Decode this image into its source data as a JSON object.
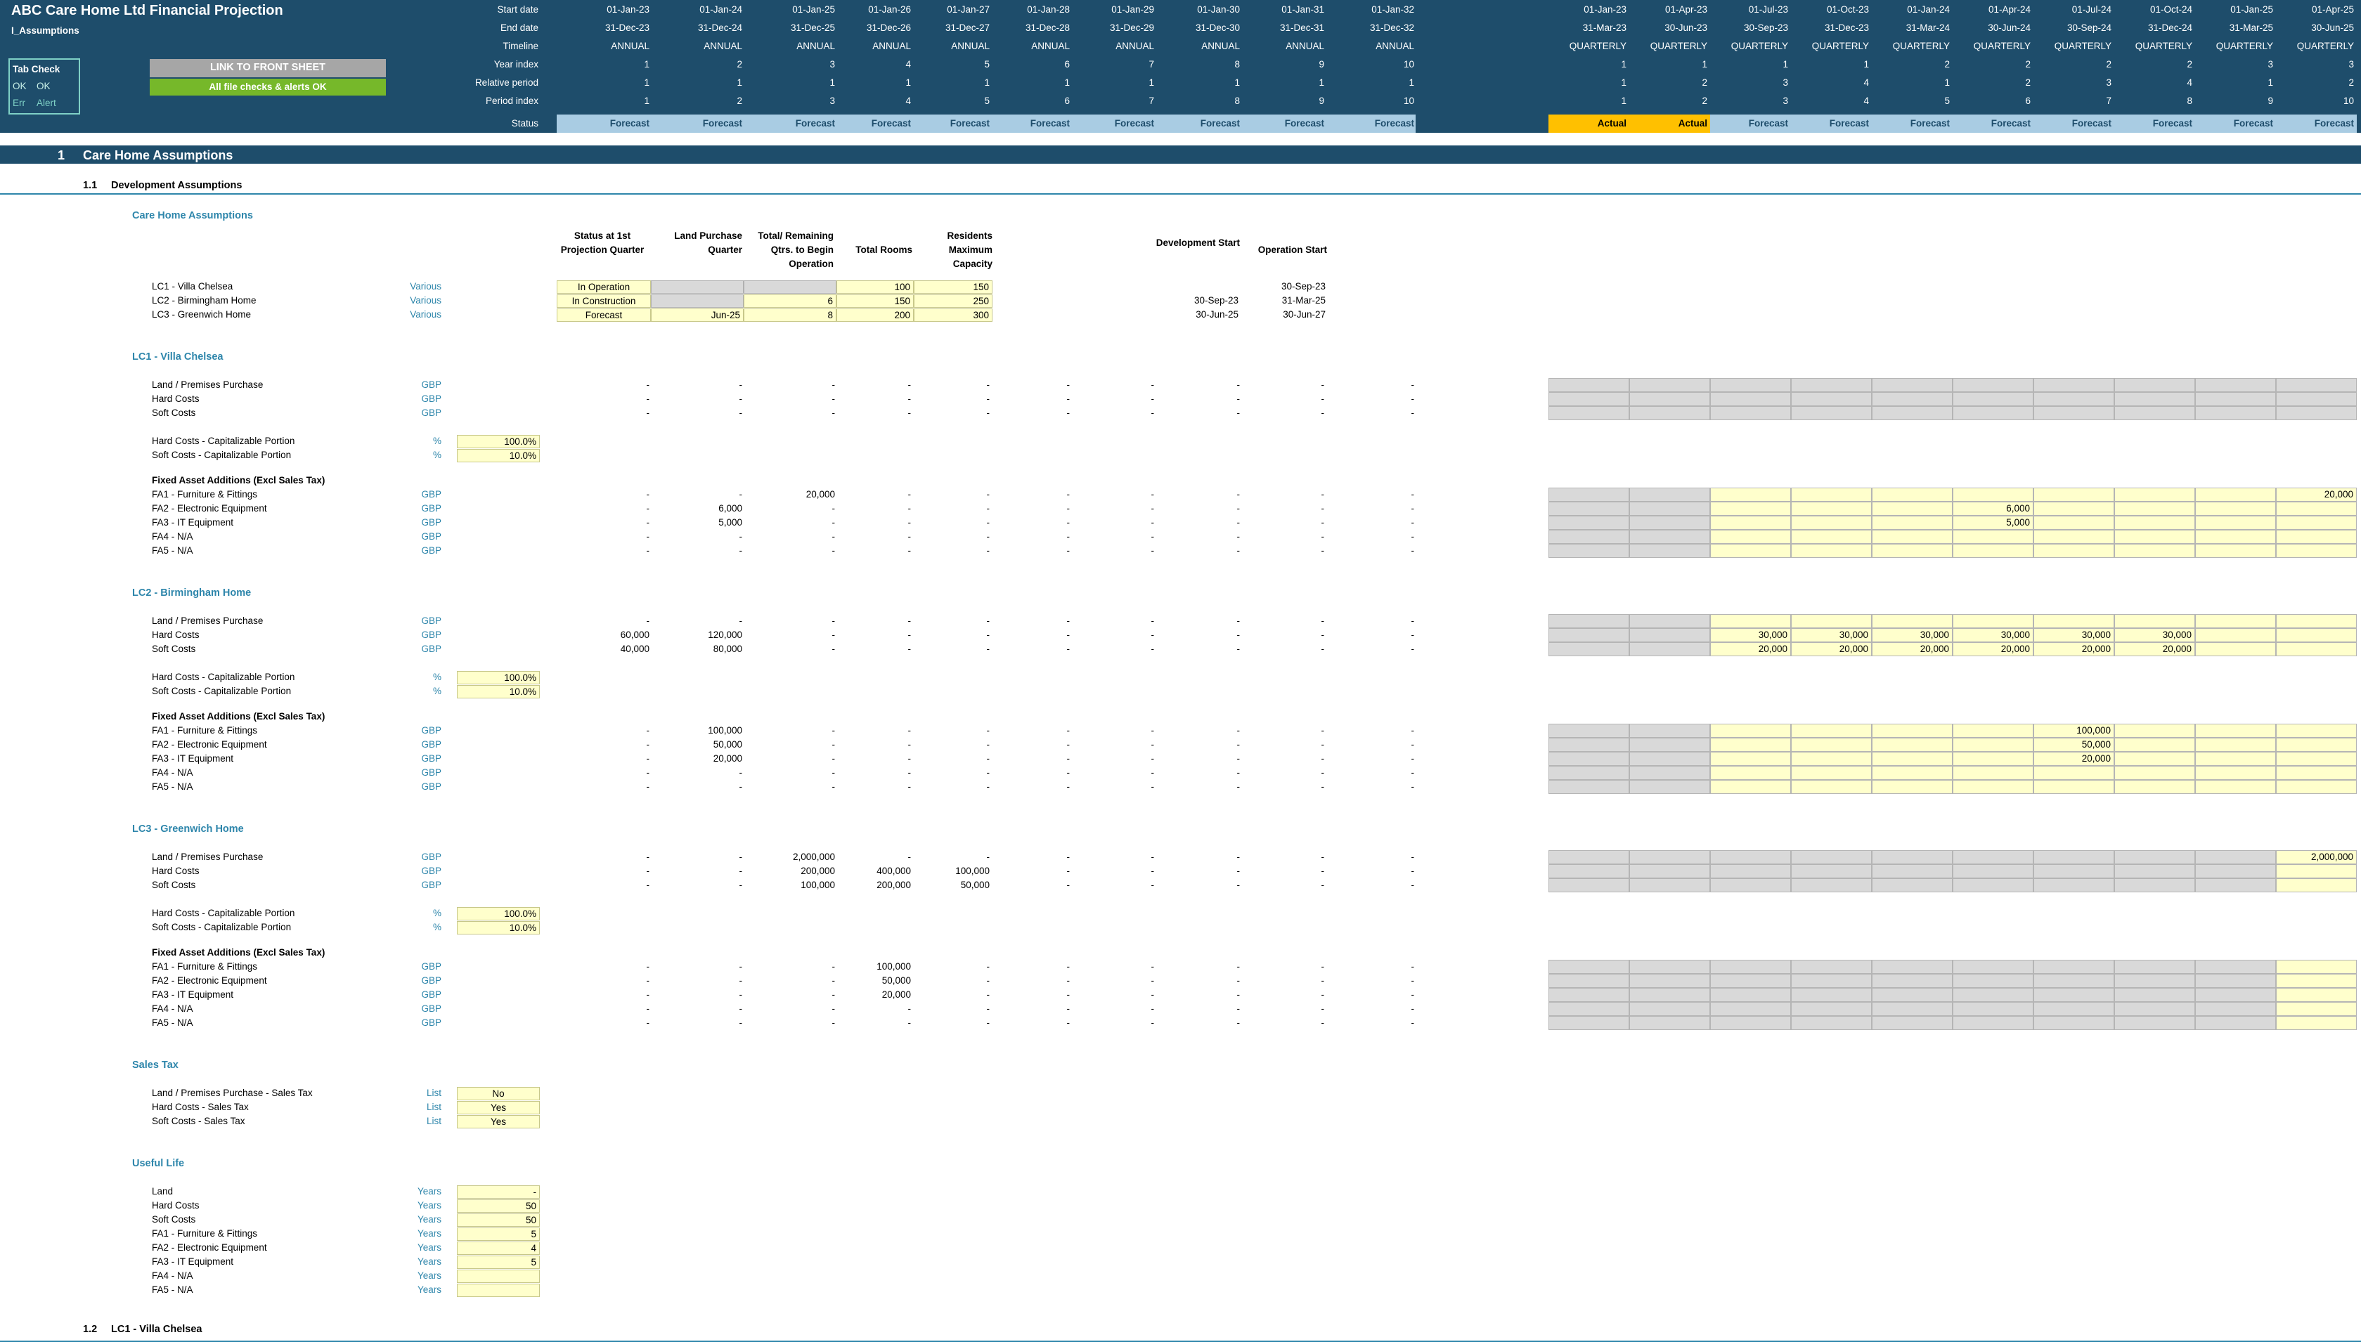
{
  "title": "ABC Care Home Ltd Financial Projection",
  "sheet": "I_Assumptions",
  "tabcheck": {
    "title": "Tab Check",
    "ok1": "OK",
    "ok2": "OK",
    "err": "Err",
    "alert": "Alert"
  },
  "buttons": {
    "link": "LINK TO FRONT SHEET",
    "checks": "All file checks & alerts OK"
  },
  "timeline": {
    "labels": [
      "Start date",
      "End date",
      "Timeline",
      "Year index",
      "Relative period",
      "Period index",
      "Status"
    ],
    "annual": [
      [
        "01-Jan-23",
        "31-Dec-23",
        "ANNUAL",
        "1",
        "1",
        "1",
        "Forecast"
      ],
      [
        "01-Jan-24",
        "31-Dec-24",
        "ANNUAL",
        "2",
        "1",
        "2",
        "Forecast"
      ],
      [
        "01-Jan-25",
        "31-Dec-25",
        "ANNUAL",
        "3",
        "1",
        "3",
        "Forecast"
      ],
      [
        "01-Jan-26",
        "31-Dec-26",
        "ANNUAL",
        "4",
        "1",
        "4",
        "Forecast"
      ],
      [
        "01-Jan-27",
        "31-Dec-27",
        "ANNUAL",
        "5",
        "1",
        "5",
        "Forecast"
      ],
      [
        "01-Jan-28",
        "31-Dec-28",
        "ANNUAL",
        "6",
        "1",
        "6",
        "Forecast"
      ],
      [
        "01-Jan-29",
        "31-Dec-29",
        "ANNUAL",
        "7",
        "1",
        "7",
        "Forecast"
      ],
      [
        "01-Jan-30",
        "31-Dec-30",
        "ANNUAL",
        "8",
        "1",
        "8",
        "Forecast"
      ],
      [
        "01-Jan-31",
        "31-Dec-31",
        "ANNUAL",
        "9",
        "1",
        "9",
        "Forecast"
      ],
      [
        "01-Jan-32",
        "31-Dec-32",
        "ANNUAL",
        "10",
        "1",
        "10",
        "Forecast"
      ]
    ],
    "quarterly": [
      [
        "01-Jan-23",
        "31-Mar-23",
        "QUARTERLY",
        "1",
        "1",
        "1",
        "Actual"
      ],
      [
        "01-Apr-23",
        "30-Jun-23",
        "QUARTERLY",
        "1",
        "2",
        "2",
        "Actual"
      ],
      [
        "01-Jul-23",
        "30-Sep-23",
        "QUARTERLY",
        "1",
        "3",
        "3",
        "Forecast"
      ],
      [
        "01-Oct-23",
        "31-Dec-23",
        "QUARTERLY",
        "1",
        "4",
        "4",
        "Forecast"
      ],
      [
        "01-Jan-24",
        "31-Mar-24",
        "QUARTERLY",
        "2",
        "1",
        "5",
        "Forecast"
      ],
      [
        "01-Apr-24",
        "30-Jun-24",
        "QUARTERLY",
        "2",
        "2",
        "6",
        "Forecast"
      ],
      [
        "01-Jul-24",
        "30-Sep-24",
        "QUARTERLY",
        "2",
        "3",
        "7",
        "Forecast"
      ],
      [
        "01-Oct-24",
        "31-Dec-24",
        "QUARTERLY",
        "2",
        "4",
        "8",
        "Forecast"
      ],
      [
        "01-Jan-25",
        "31-Mar-25",
        "QUARTERLY",
        "3",
        "1",
        "9",
        "Forecast"
      ],
      [
        "01-Apr-25",
        "30-Jun-25",
        "QUARTERLY",
        "3",
        "2",
        "10",
        "Forecast"
      ]
    ]
  },
  "section": {
    "num": "1",
    "title": "Care Home Assumptions",
    "sub_num": "1.1",
    "sub_title": "Development Assumptions",
    "next_num": "1.2",
    "next_title": "LC1 - Villa Chelsea"
  },
  "care": {
    "title": "Care Home Assumptions",
    "headers": {
      "status": "Status at 1st Projection Quarter",
      "land": "Land Purchase Quarter",
      "qtrs": "Total/ Remaining Qtrs. to Begin Operation",
      "rooms": "Total Rooms",
      "residents": "Residents Maximum Capacity",
      "dev": "Development Start",
      "op": "Operation Start"
    },
    "rows": [
      {
        "name": "LC1 - Villa Chelsea",
        "unit": "Various",
        "status": "In Operation",
        "land": "",
        "qtrs": "",
        "rooms": "100",
        "residents": "150",
        "dev": "",
        "op": "30-Sep-23"
      },
      {
        "name": "LC2 - Birmingham Home",
        "unit": "Various",
        "status": "In Construction",
        "land": "",
        "qtrs": "6",
        "rooms": "150",
        "residents": "250",
        "dev": "30-Sep-23",
        "op": "31-Mar-25"
      },
      {
        "name": "LC3 - Greenwich Home",
        "unit": "Various",
        "status": "Forecast",
        "land": "Jun-25",
        "qtrs": "8",
        "rooms": "200",
        "residents": "300",
        "dev": "30-Jun-25",
        "op": "30-Jun-27"
      }
    ]
  },
  "homes": [
    {
      "title": "LC1 - Villa Chelsea",
      "costs": [
        {
          "label": "Land / Premises Purchase",
          "unit": "GBP",
          "annual": [
            "-",
            "-",
            "-",
            "-",
            "-",
            "-",
            "-",
            "-",
            "-",
            "-"
          ],
          "q": [
            "",
            "",
            "",
            "",
            "",
            "",
            "",
            "",
            "",
            ""
          ]
        },
        {
          "label": "Hard Costs",
          "unit": "GBP",
          "annual": [
            "-",
            "-",
            "-",
            "-",
            "-",
            "-",
            "-",
            "-",
            "-",
            "-"
          ],
          "q": [
            "",
            "",
            "",
            "",
            "",
            "",
            "",
            "",
            "",
            ""
          ]
        },
        {
          "label": "Soft Costs",
          "unit": "GBP",
          "annual": [
            "-",
            "-",
            "-",
            "-",
            "-",
            "-",
            "-",
            "-",
            "-",
            "-"
          ],
          "q": [
            "",
            "",
            "",
            "",
            "",
            "",
            "",
            "",
            "",
            ""
          ]
        }
      ],
      "cap": [
        {
          "label": "Hard Costs - Capitalizable Portion",
          "unit": "%",
          "value": "100.0%"
        },
        {
          "label": "Soft Costs - Capitalizable Portion",
          "unit": "%",
          "value": "10.0%"
        }
      ],
      "fa_title": "Fixed Asset Additions (Excl Sales Tax)",
      "fa": [
        {
          "label": "FA1 - Furniture & Fittings",
          "unit": "GBP",
          "annual": [
            "-",
            "-",
            "20,000",
            "-",
            "-",
            "-",
            "-",
            "-",
            "-",
            "-"
          ],
          "q": [
            "",
            "",
            "",
            "",
            "",
            "",
            "",
            "",
            "",
            "20,000"
          ]
        },
        {
          "label": "FA2 - Electronic Equipment",
          "unit": "GBP",
          "annual": [
            "-",
            "6,000",
            "-",
            "-",
            "-",
            "-",
            "-",
            "-",
            "-",
            "-"
          ],
          "q": [
            "",
            "",
            "",
            "",
            "",
            "6,000",
            "",
            "",
            "",
            ""
          ]
        },
        {
          "label": "FA3 - IT Equipment",
          "unit": "GBP",
          "annual": [
            "-",
            "5,000",
            "-",
            "-",
            "-",
            "-",
            "-",
            "-",
            "-",
            "-"
          ],
          "q": [
            "",
            "",
            "",
            "",
            "",
            "5,000",
            "",
            "",
            "",
            ""
          ]
        },
        {
          "label": "FA4 - N/A",
          "unit": "GBP",
          "annual": [
            "-",
            "-",
            "-",
            "-",
            "-",
            "-",
            "-",
            "-",
            "-",
            "-"
          ],
          "q": [
            "",
            "",
            "",
            "",
            "",
            "",
            "",
            "",
            "",
            ""
          ]
        },
        {
          "label": "FA5 - N/A",
          "unit": "GBP",
          "annual": [
            "-",
            "-",
            "-",
            "-",
            "-",
            "-",
            "-",
            "-",
            "-",
            "-"
          ],
          "q": [
            "",
            "",
            "",
            "",
            "",
            "",
            "",
            "",
            "",
            ""
          ]
        }
      ]
    },
    {
      "title": "LC2 - Birmingham Home",
      "costs": [
        {
          "label": "Land / Premises Purchase",
          "unit": "GBP",
          "annual": [
            "-",
            "-",
            "-",
            "-",
            "-",
            "-",
            "-",
            "-",
            "-",
            "-"
          ],
          "q": [
            "",
            "",
            "",
            "",
            "",
            "",
            "",
            "",
            "",
            ""
          ]
        },
        {
          "label": "Hard Costs",
          "unit": "GBP",
          "annual": [
            "60,000",
            "120,000",
            "-",
            "-",
            "-",
            "-",
            "-",
            "-",
            "-",
            "-"
          ],
          "q": [
            "",
            "",
            "30,000",
            "30,000",
            "30,000",
            "30,000",
            "30,000",
            "30,000",
            "",
            ""
          ]
        },
        {
          "label": "Soft Costs",
          "unit": "GBP",
          "annual": [
            "40,000",
            "80,000",
            "-",
            "-",
            "-",
            "-",
            "-",
            "-",
            "-",
            "-"
          ],
          "q": [
            "",
            "",
            "20,000",
            "20,000",
            "20,000",
            "20,000",
            "20,000",
            "20,000",
            "",
            ""
          ]
        }
      ],
      "cap": [
        {
          "label": "Hard Costs - Capitalizable Portion",
          "unit": "%",
          "value": "100.0%"
        },
        {
          "label": "Soft Costs - Capitalizable Portion",
          "unit": "%",
          "value": "10.0%"
        }
      ],
      "fa_title": "Fixed Asset Additions (Excl Sales Tax)",
      "fa": [
        {
          "label": "FA1 - Furniture & Fittings",
          "unit": "GBP",
          "annual": [
            "-",
            "100,000",
            "-",
            "-",
            "-",
            "-",
            "-",
            "-",
            "-",
            "-"
          ],
          "q": [
            "",
            "",
            "",
            "",
            "",
            "",
            "100,000",
            "",
            "",
            ""
          ]
        },
        {
          "label": "FA2 - Electronic Equipment",
          "unit": "GBP",
          "annual": [
            "-",
            "50,000",
            "-",
            "-",
            "-",
            "-",
            "-",
            "-",
            "-",
            "-"
          ],
          "q": [
            "",
            "",
            "",
            "",
            "",
            "",
            "50,000",
            "",
            "",
            ""
          ]
        },
        {
          "label": "FA3 - IT Equipment",
          "unit": "GBP",
          "annual": [
            "-",
            "20,000",
            "-",
            "-",
            "-",
            "-",
            "-",
            "-",
            "-",
            "-"
          ],
          "q": [
            "",
            "",
            "",
            "",
            "",
            "",
            "20,000",
            "",
            "",
            ""
          ]
        },
        {
          "label": "FA4 - N/A",
          "unit": "GBP",
          "annual": [
            "-",
            "-",
            "-",
            "-",
            "-",
            "-",
            "-",
            "-",
            "-",
            "-"
          ],
          "q": [
            "",
            "",
            "",
            "",
            "",
            "",
            "",
            "",
            "",
            ""
          ]
        },
        {
          "label": "FA5 - N/A",
          "unit": "GBP",
          "annual": [
            "-",
            "-",
            "-",
            "-",
            "-",
            "-",
            "-",
            "-",
            "-",
            "-"
          ],
          "q": [
            "",
            "",
            "",
            "",
            "",
            "",
            "",
            "",
            "",
            ""
          ]
        }
      ]
    },
    {
      "title": "LC3 - Greenwich Home",
      "costs": [
        {
          "label": "Land / Premises Purchase",
          "unit": "GBP",
          "annual": [
            "-",
            "-",
            "2,000,000",
            "-",
            "-",
            "-",
            "-",
            "-",
            "-",
            "-"
          ],
          "q": [
            "",
            "",
            "",
            "",
            "",
            "",
            "",
            "",
            "",
            "2,000,000"
          ]
        },
        {
          "label": "Hard Costs",
          "unit": "GBP",
          "annual": [
            "-",
            "-",
            "200,000",
            "400,000",
            "100,000",
            "-",
            "-",
            "-",
            "-",
            "-"
          ],
          "q": [
            "",
            "",
            "",
            "",
            "",
            "",
            "",
            "",
            "",
            ""
          ]
        },
        {
          "label": "Soft Costs",
          "unit": "GBP",
          "annual": [
            "-",
            "-",
            "100,000",
            "200,000",
            "50,000",
            "-",
            "-",
            "-",
            "-",
            "-"
          ],
          "q": [
            "",
            "",
            "",
            "",
            "",
            "",
            "",
            "",
            "",
            ""
          ]
        }
      ],
      "cap": [
        {
          "label": "Hard Costs - Capitalizable Portion",
          "unit": "%",
          "value": "100.0%"
        },
        {
          "label": "Soft Costs - Capitalizable Portion",
          "unit": "%",
          "value": "10.0%"
        }
      ],
      "fa_title": "Fixed Asset Additions (Excl Sales Tax)",
      "fa": [
        {
          "label": "FA1 - Furniture & Fittings",
          "unit": "GBP",
          "annual": [
            "-",
            "-",
            "-",
            "100,000",
            "-",
            "-",
            "-",
            "-",
            "-",
            "-"
          ],
          "q": [
            "",
            "",
            "",
            "",
            "",
            "",
            "",
            "",
            "",
            ""
          ]
        },
        {
          "label": "FA2 - Electronic Equipment",
          "unit": "GBP",
          "annual": [
            "-",
            "-",
            "-",
            "50,000",
            "-",
            "-",
            "-",
            "-",
            "-",
            "-"
          ],
          "q": [
            "",
            "",
            "",
            "",
            "",
            "",
            "",
            "",
            "",
            ""
          ]
        },
        {
          "label": "FA3 - IT Equipment",
          "unit": "GBP",
          "annual": [
            "-",
            "-",
            "-",
            "20,000",
            "-",
            "-",
            "-",
            "-",
            "-",
            "-"
          ],
          "q": [
            "",
            "",
            "",
            "",
            "",
            "",
            "",
            "",
            "",
            ""
          ]
        },
        {
          "label": "FA4 - N/A",
          "unit": "GBP",
          "annual": [
            "-",
            "-",
            "-",
            "-",
            "-",
            "-",
            "-",
            "-",
            "-",
            "-"
          ],
          "q": [
            "",
            "",
            "",
            "",
            "",
            "",
            "",
            "",
            "",
            ""
          ]
        },
        {
          "label": "FA5 - N/A",
          "unit": "GBP",
          "annual": [
            "-",
            "-",
            "-",
            "-",
            "-",
            "-",
            "-",
            "-",
            "-",
            "-"
          ],
          "q": [
            "",
            "",
            "",
            "",
            "",
            "",
            "",
            "",
            "",
            ""
          ]
        }
      ]
    }
  ],
  "sales_tax": {
    "title": "Sales Tax",
    "rows": [
      {
        "label": "Land / Premises Purchase - Sales Tax",
        "unit": "List",
        "value": "No"
      },
      {
        "label": "Hard Costs - Sales Tax",
        "unit": "List",
        "value": "Yes"
      },
      {
        "label": "Soft Costs - Sales Tax",
        "unit": "List",
        "value": "Yes"
      }
    ]
  },
  "useful_life": {
    "title": "Useful Life",
    "rows": [
      {
        "label": "Land",
        "unit": "Years",
        "value": "-"
      },
      {
        "label": "Hard Costs",
        "unit": "Years",
        "value": "50"
      },
      {
        "label": "Soft Costs",
        "unit": "Years",
        "value": "50"
      },
      {
        "label": "FA1 - Furniture & Fittings",
        "unit": "Years",
        "value": "5"
      },
      {
        "label": "FA2 - Electronic Equipment",
        "unit": "Years",
        "value": "4"
      },
      {
        "label": "FA3 - IT Equipment",
        "unit": "Years",
        "value": "5"
      },
      {
        "label": "FA4 - N/A",
        "unit": "Years",
        "value": ""
      },
      {
        "label": "FA5 - N/A",
        "unit": "Years",
        "value": ""
      }
    ]
  },
  "colors": {
    "header": "#1e4d6b",
    "teal": "#2e86ab",
    "input": "#ffffcc",
    "locked": "#d9d9d9",
    "actual": "#ffc000",
    "forecast": "#a9cce3"
  }
}
